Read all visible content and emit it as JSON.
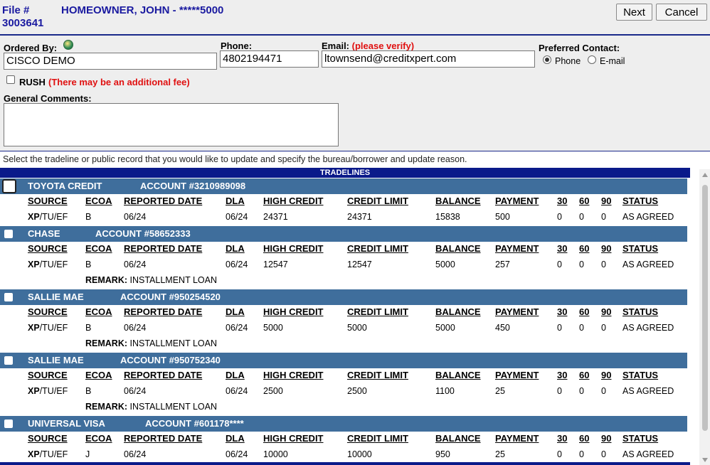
{
  "header": {
    "file_label": "File #",
    "file_number": "3003641",
    "owner": "HOMEOWNER, JOHN - *****5000",
    "next_label": "Next",
    "cancel_label": "Cancel"
  },
  "form": {
    "ordered_by_label": "Ordered By:",
    "ordered_by_value": "CISCO DEMO",
    "phone_label": "Phone:",
    "phone_value": "4802194471",
    "email_label": "Email:",
    "email_verify": "(please verify)",
    "email_value": "ltownsend@creditxpert.com",
    "preferred_label": "Preferred Contact:",
    "pref_phone": "Phone",
    "pref_email": "E-mail",
    "pref_selected": "Phone",
    "rush_label": "RUSH",
    "rush_note": "(There may be an additional fee)",
    "comments_label": "General Comments:",
    "comments_value": ""
  },
  "instructions": "Select the tradeline or public record that you would like to update and specify the bureau/borrower and update reason.",
  "tradelines_title": "TRADELINES",
  "columns": [
    "SOURCE",
    "ECOA",
    "REPORTED DATE",
    "DLA",
    "HIGH CREDIT",
    "CREDIT LIMIT",
    "BALANCE",
    "PAYMENT",
    "30",
    "60",
    "90",
    "STATUS"
  ],
  "remark_label": "REMARK:",
  "tradelines": [
    {
      "creditor": "TOYOTA CREDIT",
      "account": "ACCOUNT #3210989098",
      "source_bold": "XP",
      "source_rest": "/TU/EF",
      "ecoa": "B",
      "reported": "06/24",
      "dla": "06/24",
      "high_credit": "24371",
      "credit_limit": "24371",
      "balance": "15838",
      "payment": "500",
      "d30": "0",
      "d60": "0",
      "d90": "0",
      "status": "AS AGREED",
      "remark": ""
    },
    {
      "creditor": "CHASE",
      "account": "ACCOUNT #58652333",
      "source_bold": "XP",
      "source_rest": "/TU/EF",
      "ecoa": "B",
      "reported": "06/24",
      "dla": "06/24",
      "high_credit": "12547",
      "credit_limit": "12547",
      "balance": "5000",
      "payment": "257",
      "d30": "0",
      "d60": "0",
      "d90": "0",
      "status": "AS AGREED",
      "remark": "INSTALLMENT LOAN"
    },
    {
      "creditor": "SALLIE MAE",
      "account": "ACCOUNT #950254520",
      "source_bold": "XP",
      "source_rest": "/TU/EF",
      "ecoa": "B",
      "reported": "06/24",
      "dla": "06/24",
      "high_credit": "5000",
      "credit_limit": "5000",
      "balance": "5000",
      "payment": "450",
      "d30": "0",
      "d60": "0",
      "d90": "0",
      "status": "AS AGREED",
      "remark": "INSTALLMENT LOAN"
    },
    {
      "creditor": "SALLIE MAE",
      "account": "ACCOUNT #950752340",
      "source_bold": "XP",
      "source_rest": "/TU/EF",
      "ecoa": "B",
      "reported": "06/24",
      "dla": "06/24",
      "high_credit": "2500",
      "credit_limit": "2500",
      "balance": "1100",
      "payment": "25",
      "d30": "0",
      "d60": "0",
      "d90": "0",
      "status": "AS AGREED",
      "remark": "INSTALLMENT LOAN"
    },
    {
      "creditor": "UNIVERSAL VISA",
      "account": "ACCOUNT #601178****",
      "source_bold": "XP",
      "source_rest": "/TU/EF",
      "ecoa": "J",
      "reported": "06/24",
      "dla": "06/24",
      "high_credit": "10000",
      "credit_limit": "10000",
      "balance": "950",
      "payment": "25",
      "d30": "0",
      "d60": "0",
      "d90": "0",
      "status": "AS AGREED",
      "remark": ""
    }
  ]
}
